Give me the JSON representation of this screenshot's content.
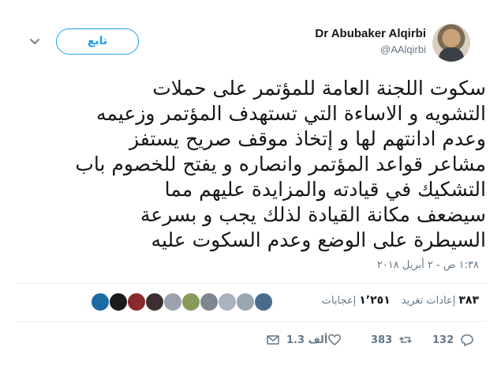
{
  "header": {
    "name": "Dr Abubaker Alqirbi",
    "handle": "@AAlqirbi",
    "follow_label": "تابع"
  },
  "tweet": {
    "lines": [
      "سكوت اللجنة العامة للمؤتمر على حملات",
      "التشويه و الاساءة التي تستهدف المؤتمر وزعيمه",
      "وعدم ادانتهم لها و إتخاذ موقف صريح يستفز",
      "مشاعر قواعد المؤتمر  وانصاره و يفتح للخصوم باب",
      "التشكيك في قيادته والمزايدة عليهم مما",
      "سيضعف مكانة القيادة لذلك يجب و بسرعة",
      "السيطرة على الوضع وعدم السكوت عليه"
    ],
    "timestamp": "١:٣٨ ص - ٢ أبريل ٢٠١٨"
  },
  "stats": {
    "retweets_count": "٣٨٣",
    "retweets_label": "إعادات تغريد",
    "likes_count": "١٬٢٥١",
    "likes_label": "إعجابات"
  },
  "likers": [
    {
      "name": "liker-1",
      "color": "#1c6aa3"
    },
    {
      "name": "liker-2",
      "color": "#1a1a1a"
    },
    {
      "name": "liker-3",
      "color": "#8a2a2a"
    },
    {
      "name": "liker-4",
      "color": "#3b2f2f"
    },
    {
      "name": "liker-5",
      "color": "#9aa3ad"
    },
    {
      "name": "liker-6",
      "color": "#8a9a5b"
    },
    {
      "name": "liker-7",
      "color": "#7d8791"
    },
    {
      "name": "liker-8",
      "color": "#aab4be"
    },
    {
      "name": "liker-9",
      "color": "#9aa6b2"
    },
    {
      "name": "liker-10",
      "color": "#4a6b8a"
    }
  ],
  "actions": {
    "reply_count": "132",
    "retweet_count": "383",
    "like_count": "1.3 ألف"
  },
  "colors": {
    "accent": "#1da1f2",
    "muted": "#657786",
    "text": "#14171a"
  }
}
